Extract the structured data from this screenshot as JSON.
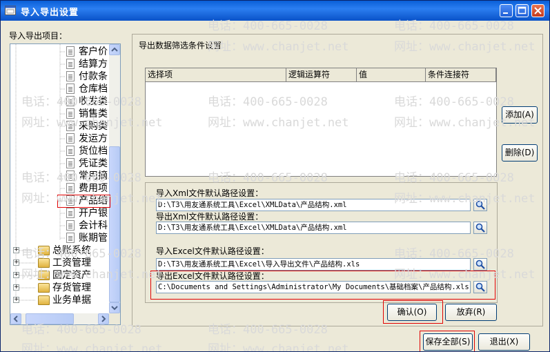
{
  "window": {
    "title": "导入导出设置"
  },
  "left_panel": {
    "label": "导入导出项目："
  },
  "tree": {
    "children": [
      "客户价",
      "结算方",
      "付款条",
      "仓库档",
      "收发类",
      "销售类",
      "采购类",
      "发运方",
      "货位档",
      "凭证类",
      "常用摘",
      "费用项",
      "产品结",
      "开户银",
      "会计科",
      "账期管"
    ],
    "groups": [
      "总账系统",
      "工资管理",
      "固定资产",
      "存货管理",
      "业务单据"
    ]
  },
  "filter": {
    "label": "导出数据筛选条件设置",
    "columns": [
      "选择项",
      "逻辑运算符",
      "值",
      "条件连接符"
    ],
    "add_label": "添加(A)",
    "delete_label": "删除(D)"
  },
  "paths": {
    "import_xml_label": "导入Xml文件默认路径设置：",
    "import_xml_value": "D:\\T3\\用友通系统工具\\Excel\\XMLData\\产品结构.xml",
    "export_xml_label": "导出Xml文件默认路径设置：",
    "export_xml_value": "D:\\T3\\用友通系统工具\\Excel\\XMLData\\产品结构.xml",
    "import_excel_label": "导入Excel文件默认路径设置：",
    "import_excel_value": "D:\\T3\\用友通系统工具\\Excel\\导入导出文件\\产品结构.xls",
    "export_excel_label": "导出Excel文件默认路径设置：",
    "export_excel_value": "C:\\Documents and Settings\\Administrator\\My Documents\\基础档案\\产品结构.xls"
  },
  "buttons": {
    "confirm": "确认(O)",
    "discard": "放弃(R)",
    "save_all": "保存全部(S)",
    "exit": "退出(X)"
  },
  "watermark": {
    "phone": "电话：400-665-0028",
    "site": "网址：www.chanjet.net"
  }
}
